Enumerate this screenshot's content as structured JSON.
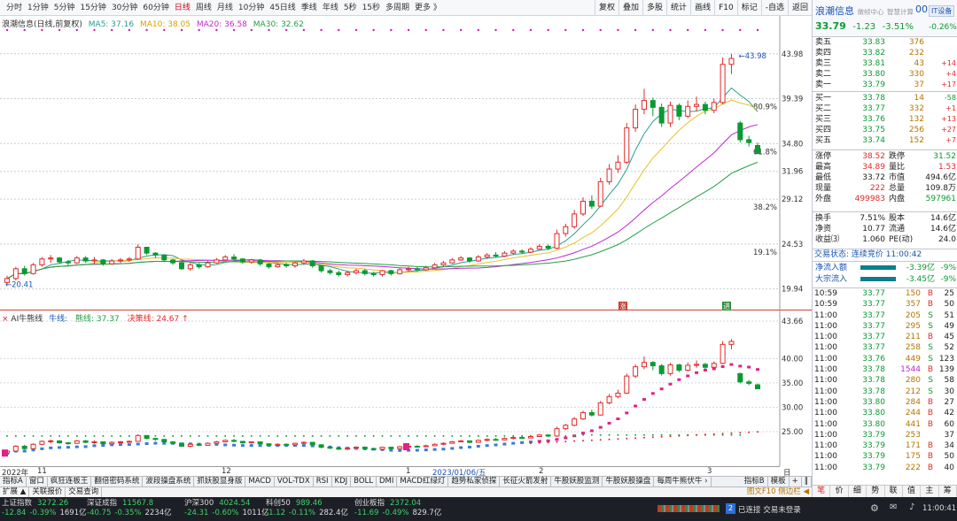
{
  "toolbar": {
    "periods": [
      "分时",
      "1分钟",
      "5分钟",
      "15分钟",
      "30分钟",
      "60分钟",
      "日线",
      "周线",
      "月线",
      "10分钟",
      "45日线",
      "季线",
      "年线",
      "5秒",
      "15秒",
      "多周期",
      "更多 》"
    ],
    "active_period": "日线",
    "tools": [
      "复权",
      "叠加",
      "多股",
      "统计",
      "画线",
      "F10",
      "标记",
      "-自选",
      "返回"
    ]
  },
  "chart": {
    "title": "浪潮信息(日线,前复权)",
    "ma5": "MA5: 37.16",
    "ma10": "MA10: 38.05",
    "ma20": "MA20: 36.58",
    "ma30": "MA30: 32.62",
    "high_mark": "43.98",
    "low_mark": "20.41",
    "price_ticks": [
      "43.98",
      "39.39",
      "34.80",
      "31.96",
      "29.12",
      "24.53",
      "19.94"
    ],
    "pct_ticks": [
      "80.9%",
      "61.8%",
      "38.2%",
      "19.1%"
    ],
    "badge_zhang": "涨",
    "badge_jin": "进",
    "candles": [
      {
        "o": 20.6,
        "c": 21.0,
        "h": 21.3,
        "l": 20.4
      },
      {
        "o": 21.0,
        "c": 22.0,
        "h": 22.2,
        "l": 20.8
      },
      {
        "o": 22.0,
        "c": 21.5,
        "h": 22.3,
        "l": 21.3
      },
      {
        "o": 21.5,
        "c": 22.4,
        "h": 22.6,
        "l": 21.4
      },
      {
        "o": 22.4,
        "c": 23.0,
        "h": 23.2,
        "l": 22.2
      },
      {
        "o": 23.0,
        "c": 23.1,
        "h": 23.4,
        "l": 22.6
      },
      {
        "o": 23.1,
        "c": 22.7,
        "h": 23.2,
        "l": 22.5
      },
      {
        "o": 22.7,
        "c": 22.6,
        "h": 22.9,
        "l": 22.3
      },
      {
        "o": 22.6,
        "c": 23.1,
        "h": 23.3,
        "l": 22.5
      },
      {
        "o": 23.1,
        "c": 22.8,
        "h": 23.3,
        "l": 22.6
      },
      {
        "o": 22.8,
        "c": 22.9,
        "h": 23.2,
        "l": 22.5
      },
      {
        "o": 22.9,
        "c": 22.5,
        "h": 23.0,
        "l": 22.3
      },
      {
        "o": 22.5,
        "c": 22.8,
        "h": 23.0,
        "l": 22.4
      },
      {
        "o": 22.8,
        "c": 22.9,
        "h": 23.1,
        "l": 22.6
      },
      {
        "o": 22.9,
        "c": 23.0,
        "h": 23.2,
        "l": 22.7
      },
      {
        "o": 23.0,
        "c": 24.2,
        "h": 24.5,
        "l": 22.9
      },
      {
        "o": 24.2,
        "c": 23.6,
        "h": 24.2,
        "l": 23.4
      },
      {
        "o": 23.6,
        "c": 23.4,
        "h": 23.7,
        "l": 23.1
      },
      {
        "o": 23.4,
        "c": 22.9,
        "h": 23.5,
        "l": 22.7
      },
      {
        "o": 22.9,
        "c": 22.6,
        "h": 23.0,
        "l": 22.4
      },
      {
        "o": 22.6,
        "c": 22.0,
        "h": 22.7,
        "l": 21.9
      },
      {
        "o": 22.0,
        "c": 22.4,
        "h": 22.6,
        "l": 21.8
      },
      {
        "o": 22.4,
        "c": 22.2,
        "h": 22.6,
        "l": 22.0
      },
      {
        "o": 22.2,
        "c": 22.6,
        "h": 22.8,
        "l": 22.1
      },
      {
        "o": 22.6,
        "c": 22.9,
        "h": 23.1,
        "l": 22.5
      },
      {
        "o": 22.9,
        "c": 23.2,
        "h": 23.4,
        "l": 22.8
      },
      {
        "o": 23.2,
        "c": 23.0,
        "h": 23.5,
        "l": 22.8
      },
      {
        "o": 23.0,
        "c": 22.7,
        "h": 23.1,
        "l": 22.5
      },
      {
        "o": 22.7,
        "c": 22.9,
        "h": 23.0,
        "l": 22.5
      },
      {
        "o": 22.9,
        "c": 22.5,
        "h": 23.0,
        "l": 22.3
      },
      {
        "o": 22.5,
        "c": 22.2,
        "h": 22.6,
        "l": 22.0
      },
      {
        "o": 22.2,
        "c": 22.4,
        "h": 22.6,
        "l": 22.1
      },
      {
        "o": 22.4,
        "c": 22.3,
        "h": 22.6,
        "l": 22.1
      },
      {
        "o": 22.3,
        "c": 22.6,
        "h": 22.7,
        "l": 22.1
      },
      {
        "o": 22.6,
        "c": 22.8,
        "h": 23.0,
        "l": 22.4
      },
      {
        "o": 22.8,
        "c": 22.3,
        "h": 22.9,
        "l": 22.1
      },
      {
        "o": 22.3,
        "c": 21.8,
        "h": 22.4,
        "l": 21.6
      },
      {
        "o": 21.8,
        "c": 21.6,
        "h": 22.0,
        "l": 21.4
      },
      {
        "o": 21.6,
        "c": 21.4,
        "h": 21.8,
        "l": 21.2
      },
      {
        "o": 21.4,
        "c": 21.6,
        "h": 21.8,
        "l": 21.2
      },
      {
        "o": 21.6,
        "c": 21.8,
        "h": 22.0,
        "l": 21.4
      },
      {
        "o": 21.8,
        "c": 21.5,
        "h": 22.0,
        "l": 21.3
      },
      {
        "o": 21.5,
        "c": 21.4,
        "h": 21.7,
        "l": 21.2
      },
      {
        "o": 21.4,
        "c": 21.8,
        "h": 21.9,
        "l": 21.2
      },
      {
        "o": 21.8,
        "c": 21.5,
        "h": 21.9,
        "l": 21.3
      },
      {
        "o": 21.5,
        "c": 21.9,
        "h": 22.1,
        "l": 21.4
      },
      {
        "o": 21.9,
        "c": 22.0,
        "h": 22.2,
        "l": 21.7
      },
      {
        "o": 22.0,
        "c": 21.9,
        "h": 22.2,
        "l": 21.7
      },
      {
        "o": 21.9,
        "c": 22.1,
        "h": 22.3,
        "l": 21.8
      },
      {
        "o": 22.1,
        "c": 22.4,
        "h": 22.6,
        "l": 22.0
      },
      {
        "o": 22.4,
        "c": 22.6,
        "h": 22.8,
        "l": 22.2
      },
      {
        "o": 22.6,
        "c": 22.9,
        "h": 23.1,
        "l": 22.5
      },
      {
        "o": 22.9,
        "c": 23.1,
        "h": 23.3,
        "l": 22.8
      },
      {
        "o": 23.1,
        "c": 22.8,
        "h": 23.2,
        "l": 22.6
      },
      {
        "o": 22.8,
        "c": 23.2,
        "h": 23.4,
        "l": 22.7
      },
      {
        "o": 23.2,
        "c": 23.4,
        "h": 23.6,
        "l": 23.0
      },
      {
        "o": 23.4,
        "c": 23.3,
        "h": 23.7,
        "l": 23.1
      },
      {
        "o": 23.3,
        "c": 23.6,
        "h": 23.8,
        "l": 23.2
      },
      {
        "o": 23.6,
        "c": 23.8,
        "h": 24.0,
        "l": 23.4
      },
      {
        "o": 23.8,
        "c": 23.7,
        "h": 24.0,
        "l": 23.5
      },
      {
        "o": 23.7,
        "c": 24.0,
        "h": 24.2,
        "l": 23.6
      },
      {
        "o": 24.0,
        "c": 24.3,
        "h": 24.5,
        "l": 23.9
      },
      {
        "o": 24.3,
        "c": 24.1,
        "h": 24.5,
        "l": 23.9
      },
      {
        "o": 24.1,
        "c": 25.6,
        "h": 26.0,
        "l": 24.0
      },
      {
        "o": 25.6,
        "c": 26.3,
        "h": 26.6,
        "l": 25.3
      },
      {
        "o": 26.3,
        "c": 27.6,
        "h": 28.0,
        "l": 26.1
      },
      {
        "o": 27.6,
        "c": 28.9,
        "h": 29.3,
        "l": 27.4
      },
      {
        "o": 28.9,
        "c": 28.4,
        "h": 29.5,
        "l": 28.1
      },
      {
        "o": 28.4,
        "c": 30.9,
        "h": 31.3,
        "l": 28.3
      },
      {
        "o": 30.9,
        "c": 32.2,
        "h": 32.7,
        "l": 30.6
      },
      {
        "o": 32.2,
        "c": 32.9,
        "h": 33.6,
        "l": 31.8
      },
      {
        "o": 32.9,
        "c": 36.4,
        "h": 36.9,
        "l": 32.7
      },
      {
        "o": 36.4,
        "c": 38.3,
        "h": 38.8,
        "l": 36.0
      },
      {
        "o": 38.3,
        "c": 39.2,
        "h": 40.4,
        "l": 37.8
      },
      {
        "o": 39.2,
        "c": 38.5,
        "h": 39.5,
        "l": 37.6
      },
      {
        "o": 38.5,
        "c": 36.9,
        "h": 38.9,
        "l": 36.5
      },
      {
        "o": 36.9,
        "c": 38.7,
        "h": 39.1,
        "l": 36.5
      },
      {
        "o": 38.7,
        "c": 37.6,
        "h": 38.9,
        "l": 37.2
      },
      {
        "o": 37.6,
        "c": 38.6,
        "h": 39.2,
        "l": 37.4
      },
      {
        "o": 38.6,
        "c": 38.8,
        "h": 39.6,
        "l": 38.1
      },
      {
        "o": 38.8,
        "c": 38.2,
        "h": 39.1,
        "l": 37.8
      },
      {
        "o": 38.2,
        "c": 39.0,
        "h": 39.4,
        "l": 37.9
      },
      {
        "o": 39.0,
        "c": 42.9,
        "h": 43.6,
        "l": 38.8
      },
      {
        "o": 42.9,
        "c": 43.5,
        "h": 43.98,
        "l": 41.9
      },
      {
        "o": 36.9,
        "c": 35.2,
        "h": 37.1,
        "l": 34.9
      },
      {
        "o": 35.2,
        "c": 34.9,
        "h": 35.6,
        "l": 34.5
      },
      {
        "o": 34.6,
        "c": 33.79,
        "h": 34.89,
        "l": 33.72
      }
    ]
  },
  "indicator": {
    "title": "AI牛熊线",
    "bull_label": "牛线:",
    "bear_label": "熊线: 37.37",
    "decision_label": "决策线: 24.67 ↑",
    "ticks": [
      "43.66",
      "40.00",
      "35.00",
      "30.00",
      "25.00"
    ],
    "date_label": "2023/01/06/五",
    "xlabels": [
      "2022年",
      "11",
      "12",
      "1",
      "2",
      "3"
    ],
    "xaxis_right": "日线"
  },
  "ind_tabs": [
    "指标A",
    "窗口",
    "疯狂连板王",
    "翻倍密码系统",
    "波段操盘系统",
    "抓妖股显身版",
    "MACD",
    "VOL-TDX",
    "RSI",
    "KDJ",
    "BOLL",
    "DMI",
    "MACD红绿灯",
    "趋势私家侦探",
    "长征火箭发射",
    "牛股妖股监测",
    "牛股妖股操盘",
    "每周牛熊伏牛 ›"
  ],
  "ind_tabs_right": [
    "指标B",
    "模板",
    "+",
    "‖"
  ],
  "bottom_tabs": [
    "扩展 ▲",
    "关联报价",
    "交易查询"
  ],
  "bottom_right": "图文F10 侧边栏 ◀",
  "quote": {
    "name": "浪潮信息",
    "code": "00",
    "right_badge": "IT设备",
    "tag1": "做帧中心",
    "tag2": "智慧计算",
    "price": "33.79",
    "change": "-1.23",
    "pct": "-3.51%",
    "pct2": "-0.26%",
    "asks": [
      {
        "l": "卖五",
        "p": "33.83",
        "v": "376",
        "d": ""
      },
      {
        "l": "卖四",
        "p": "33.82",
        "v": "232",
        "d": ""
      },
      {
        "l": "卖三",
        "p": "33.81",
        "v": "43",
        "d": "+14"
      },
      {
        "l": "卖二",
        "p": "33.80",
        "v": "330",
        "d": "+4"
      },
      {
        "l": "卖一",
        "p": "33.79",
        "v": "37",
        "d": "+17"
      }
    ],
    "bids": [
      {
        "l": "买一",
        "p": "33.78",
        "v": "14",
        "d": "-58"
      },
      {
        "l": "买二",
        "p": "33.77",
        "v": "332",
        "d": "+1"
      },
      {
        "l": "买三",
        "p": "33.76",
        "v": "132",
        "d": "+13"
      },
      {
        "l": "买四",
        "p": "33.75",
        "v": "256",
        "d": "+27"
      },
      {
        "l": "买五",
        "p": "33.74",
        "v": "152",
        "d": "+7"
      }
    ],
    "stats": [
      [
        "涨停",
        "38.52",
        "跌停",
        "31.52"
      ],
      [
        "最高",
        "34.89",
        "量比",
        "1.53"
      ],
      [
        "最低",
        "33.72",
        "市值",
        "494.6亿"
      ],
      [
        "现量",
        "222",
        "总量",
        "109.8万"
      ],
      [
        "外盘",
        "499983",
        "内盘",
        "597961"
      ]
    ],
    "stats2": [
      [
        "换手",
        "7.51%",
        "股本",
        "14.6亿"
      ],
      [
        "净资",
        "10.77",
        "流通",
        "14.6亿"
      ],
      [
        "收益⑶",
        "1.060",
        "PE(动)",
        "24.0"
      ]
    ],
    "trade_status": "交易状态: 连续竞价 11:00:42",
    "flows": [
      {
        "l": "净流入额",
        "v": "-3.39亿",
        "p": "-9%"
      },
      {
        "l": "大宗流入",
        "v": "-3.45亿",
        "p": "-9%"
      }
    ],
    "ticks": [
      [
        "10:59",
        "33.77",
        "150",
        "B",
        "25"
      ],
      [
        "10:59",
        "33.77",
        "357",
        "B",
        "50"
      ],
      [
        "11:00",
        "33.77",
        "205",
        "S",
        "51"
      ],
      [
        "11:00",
        "33.77",
        "295",
        "S",
        "49"
      ],
      [
        "11:00",
        "33.77",
        "211",
        "B",
        "45"
      ],
      [
        "11:00",
        "33.77",
        "258",
        "S",
        "52"
      ],
      [
        "11:00",
        "33.76",
        "449",
        "S",
        "123"
      ],
      [
        "11:00",
        "33.78",
        "1544",
        "B",
        "139"
      ],
      [
        "11:00",
        "33.78",
        "280",
        "S",
        "58"
      ],
      [
        "11:00",
        "33.78",
        "212",
        "S",
        "30"
      ],
      [
        "11:00",
        "33.80",
        "284",
        "B",
        "27"
      ],
      [
        "11:00",
        "33.80",
        "244",
        "B",
        "42"
      ],
      [
        "11:00",
        "33.80",
        "441",
        "B",
        "60"
      ],
      [
        "11:00",
        "33.79",
        "253",
        "",
        "37"
      ],
      [
        "11:00",
        "33.79",
        "171",
        "B",
        "34"
      ],
      [
        "11:00",
        "33.79",
        "175",
        "B",
        "50"
      ],
      [
        "11:00",
        "33.79",
        "222",
        "B",
        "40"
      ]
    ],
    "bottom_tabs": [
      "笔",
      "价",
      "细",
      "势",
      "联",
      "值",
      "主",
      "筹"
    ]
  },
  "status": {
    "items": [
      {
        "name": "上证指数",
        "val": "3272.26",
        "chg": "-12.84",
        "pct": "-0.39%",
        "amt": "1691亿"
      },
      {
        "name": "深证成指",
        "val": "11567.8",
        "chg": "-40.75",
        "pct": "-0.35%",
        "amt": "2234亿"
      },
      {
        "name": "沪深300",
        "val": "4024.54",
        "chg": "-24.31",
        "pct": "-0.60%",
        "amt": "1011亿"
      },
      {
        "name": "科创50",
        "val": "989.46",
        "chg": "-1.12",
        "pct": "-0.11%",
        "amt": "282.4亿"
      },
      {
        "name": "创业板指",
        "val": "2372.04",
        "chg": "-11.69",
        "pct": "-0.49%",
        "amt": "829.7亿"
      }
    ],
    "conn": "已连接 交易未登录",
    "time": "11:00:41",
    "badge": "2"
  },
  "colors": {
    "up": "#e12a2a",
    "down": "#0a9a31",
    "ma5": "#2a9d8f",
    "ma10": "#e6c229",
    "ma20": "#c026d3",
    "ma30": "#22a046"
  }
}
